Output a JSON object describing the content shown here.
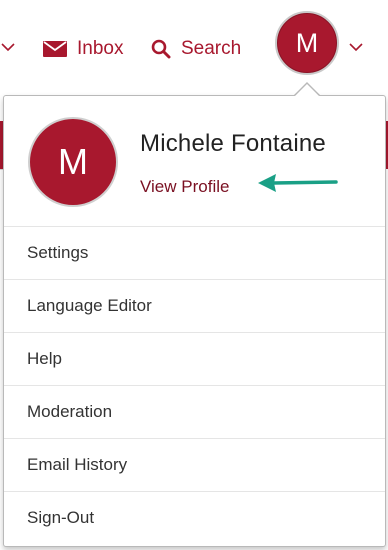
{
  "nav": {
    "inbox_label": "Inbox",
    "search_label": "Search",
    "avatar_initial": "M"
  },
  "profile": {
    "initial": "M",
    "name": "Michele Fontaine",
    "view_profile_label": "View Profile"
  },
  "menu": {
    "items": [
      {
        "label": "Settings"
      },
      {
        "label": "Language Editor"
      },
      {
        "label": "Help"
      },
      {
        "label": "Moderation"
      },
      {
        "label": "Email History"
      },
      {
        "label": "Sign-Out"
      }
    ]
  },
  "colors": {
    "brand": "#a8182e",
    "link": "#7a1022",
    "annotation_arrow": "#1aa086"
  }
}
